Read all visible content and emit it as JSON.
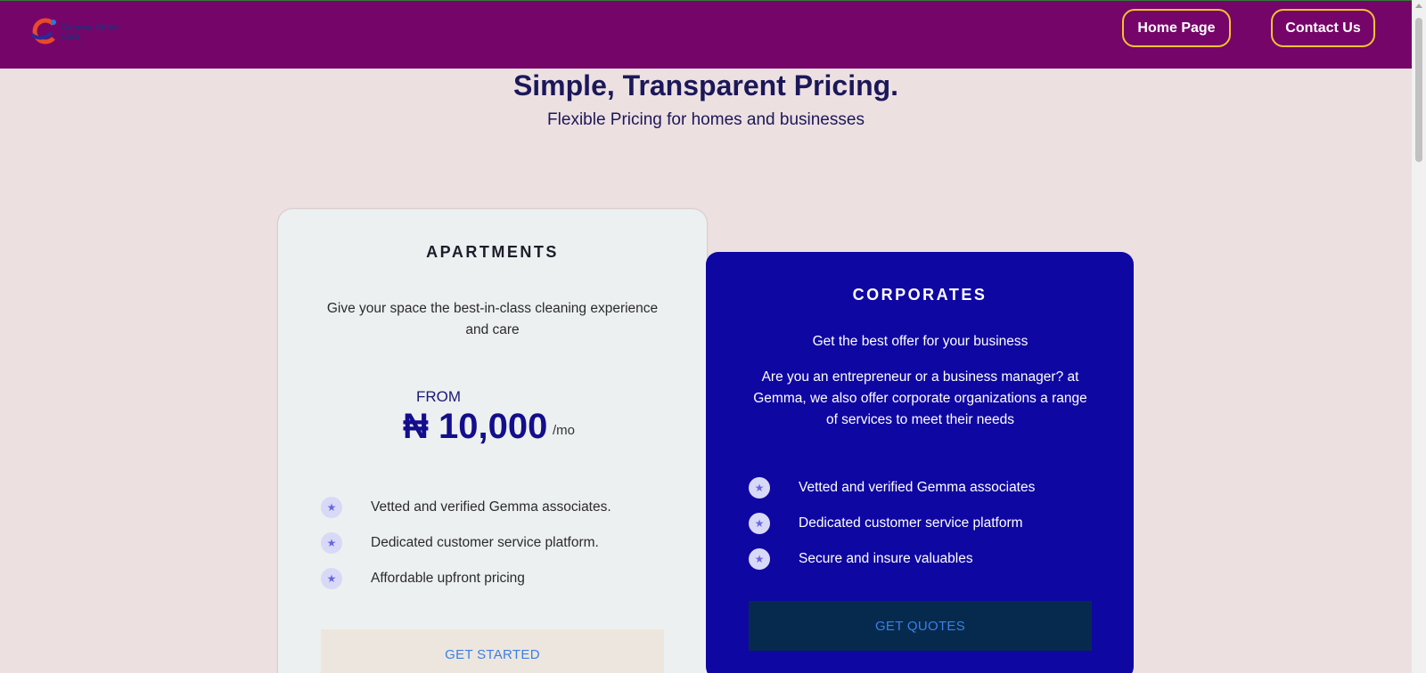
{
  "header": {
    "brand_text": "Gemma Home Care",
    "nav": {
      "home_label": "Home Page",
      "contact_label": "Contact Us"
    },
    "colors": {
      "background": "#760569",
      "button_border": "#f2c230"
    }
  },
  "hero": {
    "title": "Simple, Transparent Pricing.",
    "subtitle": "Flexible Pricing for homes and businesses"
  },
  "plans": {
    "apartments": {
      "title": "APARTMENTS",
      "description": "Give your space the best-in-class cleaning experience and care",
      "from_label": "FROM",
      "price": "₦ 10,000",
      "period": "/mo",
      "features": [
        {
          "icon": "star-icon",
          "text": "Vetted and verified Gemma associates."
        },
        {
          "icon": "star-icon",
          "text": "Dedicated customer service platform."
        },
        {
          "icon": "star-icon",
          "text": "Affordable upfront pricing"
        }
      ],
      "cta_label": "GET STARTED"
    },
    "corporates": {
      "title": "CORPORATES",
      "description": "Get the best offer for your business",
      "description_extra": "Are you an entrepreneur or a business manager? at Gemma, we also offer corporate organizations a range of services to meet their needs",
      "features": [
        {
          "icon": "star-icon",
          "text": "Vetted and verified Gemma associates"
        },
        {
          "icon": "star-icon",
          "text": "Dedicated customer service platform"
        },
        {
          "icon": "star-icon",
          "text": "Secure and insure valuables"
        }
      ],
      "cta_label": "GET QUOTES"
    }
  },
  "colors": {
    "page_background": "#ede0e1",
    "corporate_card": "#0f07a2",
    "price_color": "#120e8c",
    "cta_text": "#3b7fe6"
  }
}
